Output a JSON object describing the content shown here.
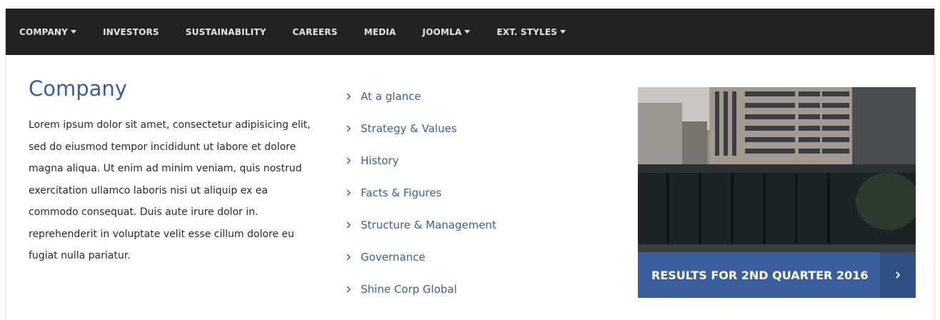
{
  "nav": {
    "items": [
      {
        "label": "COMPANY",
        "dropdown": true
      },
      {
        "label": "INVESTORS",
        "dropdown": false
      },
      {
        "label": "SUSTAINABILITY",
        "dropdown": false
      },
      {
        "label": "CAREERS",
        "dropdown": false
      },
      {
        "label": "MEDIA",
        "dropdown": false
      },
      {
        "label": "JOOMLA",
        "dropdown": true
      },
      {
        "label": "EXT. STYLES",
        "dropdown": true
      }
    ]
  },
  "company": {
    "title": "Company",
    "text": "Lorem ipsum dolor sit amet, consectetur adipisicing elit, sed do eiusmod tempor incididunt ut labore et dolore magna aliqua. Ut enim ad minim veniam, quis nostrud exercitation ullamco laboris nisi ut aliquip ex ea commodo consequat. Duis aute irure dolor in. reprehenderit in voluptate velit esse cillum dolore eu fugiat nulla pariatur."
  },
  "links": [
    "At a glance",
    "Strategy & Values",
    "History",
    "Facts & Figures",
    "Structure & Management",
    "Governance",
    "Shine Corp Global"
  ],
  "promo": {
    "label": "RESULTS FOR 2ND QUARTER 2016",
    "icon": "chevron-right-icon"
  },
  "colors": {
    "navbar": "#222222",
    "accent": "#3b5f9c",
    "accent_dark": "#2f4e83"
  }
}
